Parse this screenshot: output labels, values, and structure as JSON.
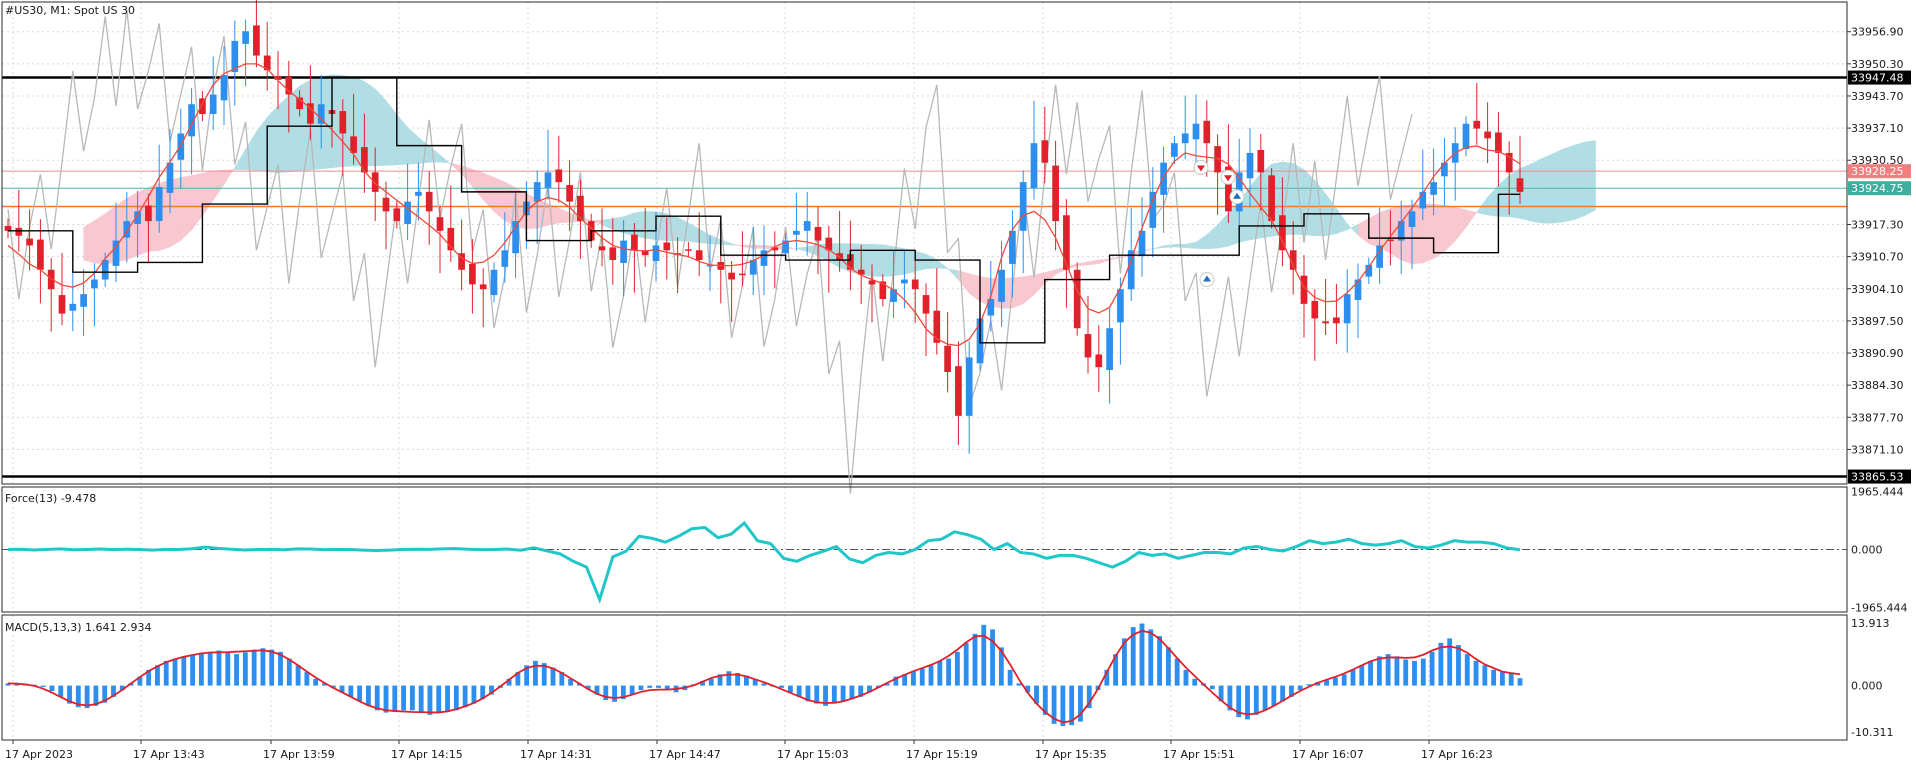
{
  "symbol_label": "#US30, M1:  Spot US 30",
  "colors": {
    "bull": "#2c8ff0",
    "bear": "#e0202a",
    "tenkan": "#f04a3a",
    "kijun": "#000000",
    "chikou": "#b8b8b8",
    "kumo_bull": "#a8dbe2",
    "kumo_bear": "#f8c2cc",
    "force": "#20c6c8",
    "macd_hist": "#2c8ff0",
    "macd_signal": "#e0202a",
    "hline_black": "#000000",
    "hline_red": "#f08a8a",
    "hline_teal": "#4fb6a4",
    "hline_orange": "#f07830"
  },
  "price_axis": {
    "ticks": [
      "33956.90",
      "33950.30",
      "33943.70",
      "33937.10",
      "33930.50",
      "33917.30",
      "33910.70",
      "33904.10",
      "33897.50",
      "33890.90",
      "33884.30",
      "33877.70",
      "33871.10"
    ],
    "tags": [
      {
        "text": "33947.48",
        "style": "black"
      },
      {
        "text": "33928.25",
        "style": "red"
      },
      {
        "text": "33924.75",
        "style": "teal"
      },
      {
        "text": "33865.53",
        "style": "black"
      }
    ]
  },
  "force_panel": {
    "label": "Force(13) -9.478",
    "ticks": [
      "1965.444",
      "0.000",
      "-1965.444"
    ]
  },
  "macd_panel": {
    "label": "MACD(5,13,3) 1.641 2.934",
    "ticks": [
      "13.913",
      "0.000",
      "-10.311"
    ]
  },
  "time_axis": [
    "17 Apr 2023",
    "17 Apr 13:43",
    "17 Apr 13:59",
    "17 Apr 14:15",
    "17 Apr 14:31",
    "17 Apr 14:47",
    "17 Apr 15:03",
    "17 Apr 15:19",
    "17 Apr 15:35",
    "17 Apr 15:51",
    "17 Apr 16:07",
    "17 Apr 16:23"
  ],
  "chart_data": {
    "type": "candlestick",
    "symbol": "#US30",
    "timeframe": "M1",
    "ylim": [
      33864,
      33963
    ],
    "horizontal_lines": [
      33947.48,
      33928.25,
      33924.75,
      33921.0,
      33865.53
    ],
    "close_series": [
      33916,
      33915,
      33913,
      33908,
      33904,
      33899,
      33901,
      33903,
      33906,
      33910,
      33914,
      33918,
      33920,
      33918,
      33925,
      33930,
      33936,
      33942,
      33940,
      33944,
      33948,
      33955,
      33957,
      33952,
      33949,
      33947,
      33944,
      33941,
      33938,
      33942,
      33940,
      33936,
      33932,
      33928,
      33924,
      33920,
      33918,
      33922,
      33924,
      33920,
      33916,
      33912,
      33908,
      33905,
      33904,
      33908,
      33912,
      33918,
      33922,
      33926,
      33928,
      33926,
      33922,
      33918,
      33914,
      33912,
      33910,
      33914,
      33912,
      33911,
      33913,
      33912,
      33911,
      33912,
      33910,
      33909,
      33908,
      33906,
      33907,
      33910,
      33912,
      33912,
      33914,
      33916,
      33918,
      33914,
      33912,
      33910,
      33908,
      33907,
      33905,
      33902,
      33904,
      33906,
      33904,
      33899,
      33893,
      33887,
      33878,
      33890,
      33898,
      33902,
      33908,
      33916,
      33926,
      33934,
      33930,
      33918,
      33908,
      33896,
      33890,
      33888,
      33896,
      33904,
      33912,
      33916,
      33924,
      33930,
      33934,
      33936,
      33938,
      33934,
      33928,
      33920,
      33928,
      33932,
      33928,
      33918,
      33912,
      33908,
      33901,
      33898,
      33897,
      33897,
      33903,
      33906,
      33909,
      33913,
      33914,
      33918,
      33920,
      33924,
      33926,
      33930,
      33934,
      33938,
      33937,
      33935,
      33932,
      33928,
      33924
    ],
    "force_series": [
      0,
      10,
      -15,
      5,
      20,
      -10,
      0,
      15,
      -5,
      10,
      0,
      -20,
      5,
      0,
      25,
      80,
      40,
      10,
      -15,
      0,
      5,
      -10,
      20,
      15,
      -5,
      0,
      0,
      -20,
      -35,
      -20,
      0,
      10,
      5,
      20,
      30,
      10,
      -5,
      0,
      15,
      -25,
      60,
      -50,
      -150,
      -400,
      -600,
      -1700,
      -250,
      -60,
      450,
      380,
      250,
      450,
      700,
      750,
      400,
      520,
      900,
      300,
      200,
      -300,
      -400,
      -200,
      -60,
      100,
      -320,
      -450,
      -200,
      -100,
      -150,
      0,
      300,
      350,
      600,
      500,
      350,
      0,
      200,
      -100,
      -150,
      -300,
      -200,
      -200,
      -300,
      -450,
      -600,
      -400,
      -100,
      -200,
      -150,
      -300,
      -200,
      -100,
      -100,
      -150,
      50,
      100,
      0,
      -50,
      100,
      300,
      200,
      250,
      350,
      200,
      150,
      200,
      300,
      100,
      50,
      150,
      300,
      250,
      250,
      200,
      50,
      -9.478
    ],
    "macd_hist": [
      0.5,
      0.6,
      0.4,
      0.2,
      -0.3,
      -1.2,
      -2.5,
      -4,
      -4.8,
      -5,
      -4.5,
      -3.8,
      -2.5,
      -1,
      0.5,
      2,
      3.5,
      4.5,
      5.5,
      6,
      6.5,
      6.8,
      7.2,
      7.5,
      7.8,
      7.5,
      7,
      7.4,
      8,
      8.3,
      8,
      7.5,
      6,
      4.5,
      3,
      1.5,
      0.5,
      -0.5,
      -1.5,
      -2.5,
      -3.5,
      -4.5,
      -5.5,
      -6,
      -5.8,
      -5.5,
      -5.5,
      -6,
      -6.5,
      -6,
      -5.8,
      -5.5,
      -4.8,
      -4,
      -3,
      -2,
      -0.5,
      1.5,
      3,
      4.5,
      5.5,
      5,
      4,
      3,
      1.5,
      0.5,
      -0.8,
      -2,
      -3.2,
      -3.6,
      -3,
      -2,
      -1,
      -0.5,
      -0.5,
      -1,
      -1.5,
      -1,
      0.3,
      1,
      1.5,
      2.5,
      3.2,
      2.8,
      2.2,
      1.5,
      0.5,
      0,
      -0.5,
      -1.5,
      -2.5,
      -3.5,
      -4,
      -4.5,
      -4,
      -3.5,
      -3,
      -2.5,
      -1.5,
      -0.5,
      0.5,
      2,
      2.5,
      3.2,
      3.8,
      4.5,
      5.5,
      6,
      7.5,
      9.5,
      11.5,
      13.5,
      12.5,
      8.5,
      3.5,
      0.5,
      -1.5,
      -4,
      -6.5,
      -8.5,
      -9,
      -8.8,
      -8,
      -5,
      -1,
      3.5,
      7,
      10.5,
      13,
      13.8,
      12.5,
      11,
      8.5,
      6,
      3.5,
      1.5,
      0.5,
      -0.8,
      -3.5,
      -5.5,
      -7,
      -7.5,
      -6.5,
      -5.5,
      -4.5,
      -3.5,
      -2.5,
      -1,
      0.3,
      0.8,
      1.2,
      1.8,
      2.5,
      3.5,
      4.5,
      5.5,
      6.5,
      7,
      6.5,
      5.8,
      5.5,
      6,
      7.5,
      9.5,
      10.5,
      9,
      7,
      5.5,
      4.5,
      3.5,
      3,
      2.934,
      1.641
    ],
    "xlabel": "",
    "ylabel": ""
  }
}
